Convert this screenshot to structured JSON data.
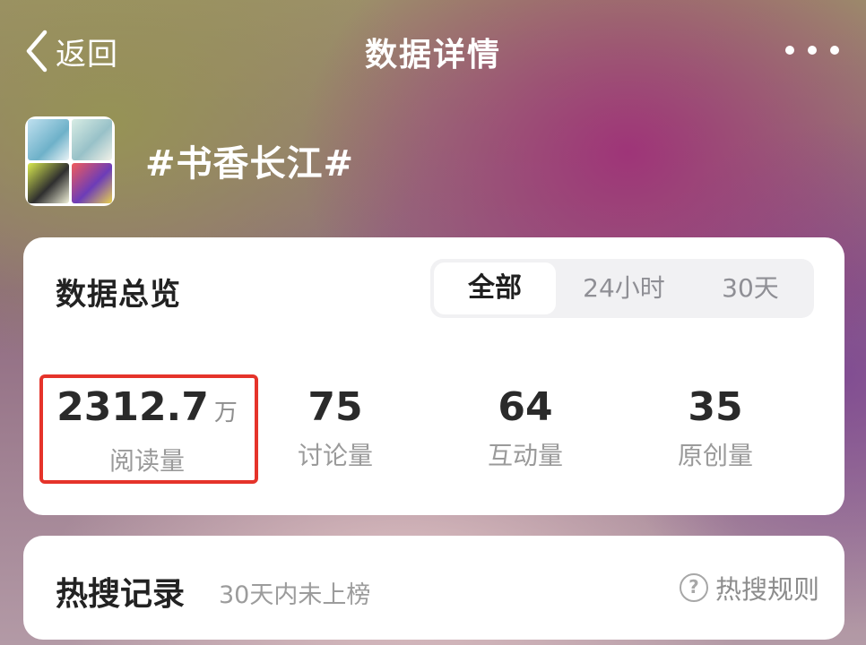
{
  "header": {
    "back_label": "返回",
    "title": "数据详情"
  },
  "topic": {
    "name": "#书香长江#"
  },
  "overview": {
    "title": "数据总览",
    "tabs": [
      {
        "label": "全部",
        "active": true
      },
      {
        "label": "24小时",
        "active": false
      },
      {
        "label": "30天",
        "active": false
      }
    ],
    "stats": [
      {
        "value": "2312.7",
        "unit": "万",
        "label": "阅读量",
        "highlighted": true
      },
      {
        "value": "75",
        "unit": "",
        "label": "讨论量"
      },
      {
        "value": "64",
        "unit": "",
        "label": "互动量"
      },
      {
        "value": "35",
        "unit": "",
        "label": "原创量"
      }
    ]
  },
  "hot_search": {
    "title": "热搜记录",
    "subtitle": "30天内未上榜",
    "rules_label": "热搜规则",
    "rules_icon_glyph": "?"
  },
  "colors": {
    "highlight_border": "#e5332a",
    "card_bg": "#ffffff"
  },
  "icons": [
    "chevron-left-icon",
    "more-dots-icon",
    "question-circle-icon"
  ]
}
